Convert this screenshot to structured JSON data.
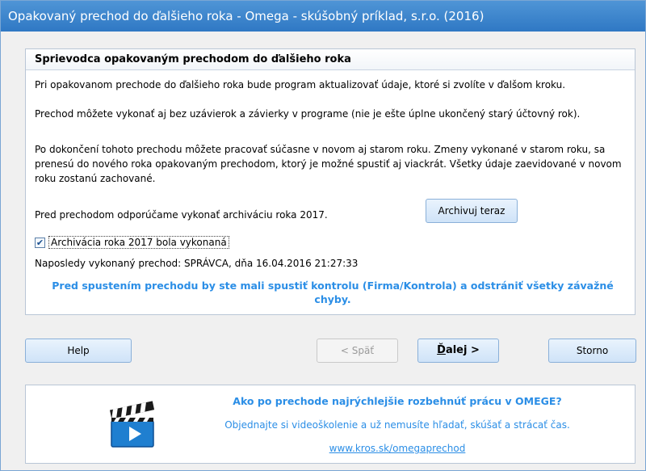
{
  "window": {
    "title": "Opakovaný prechod do ďalšieho roka - Omega - skúšobný príklad, s.r.o. (2016)"
  },
  "wizard": {
    "header": "Sprievodca opakovaným prechodom do ďalšieho roka",
    "p1": "Pri opakovanom prechode do ďalšieho roka bude program aktualizovať údaje, ktoré si zvolíte v ďalšom kroku.",
    "p2": "Prechod môžete vykonať aj bez uzávierok a závierky v programe (nie je ešte úplne ukončený starý účtovný rok).",
    "p3": "Po dokončení tohoto prechodu môžete pracovať súčasne v novom aj starom roku. Zmeny vykonané v starom roku, sa prenesú do nového roka opakovaným prechodom, ktorý je možné spustiť aj viackrát. Všetky údaje zaevidované v novom roku zostanú zachované.",
    "p4": "Pred prechodom odporúčame vykonať archiváciu roka 2017.",
    "archive_button": "Archivuj teraz",
    "checkbox_label": "Archivácia roka 2017 bola vykonaná",
    "checkbox_checked": true,
    "last_run": "Naposledy vykonaný prechod: SPRÁVCA, dňa 16.04.2016 21:27:33",
    "warning": "Pred spustením prechodu by ste mali spustiť kontrolu (Firma/Kontrola) a odstrániť všetky závažné chyby."
  },
  "buttons": {
    "help": "Help",
    "back": "< Späť",
    "next_underlined": "Ď",
    "next_rest": "alej >",
    "cancel": "Storno"
  },
  "promo": {
    "title": "Ako po prechode najrýchlejšie rozbehnúť prácu v OMEGE?",
    "subtitle": "Objednajte si videoškolenie a už nemusíte hľadať, skúšať a strácať čas.",
    "link": "www.kros.sk/omegaprechod"
  },
  "colors": {
    "title_bar": "#2f78c4",
    "accent_text": "#2b8ee6"
  }
}
